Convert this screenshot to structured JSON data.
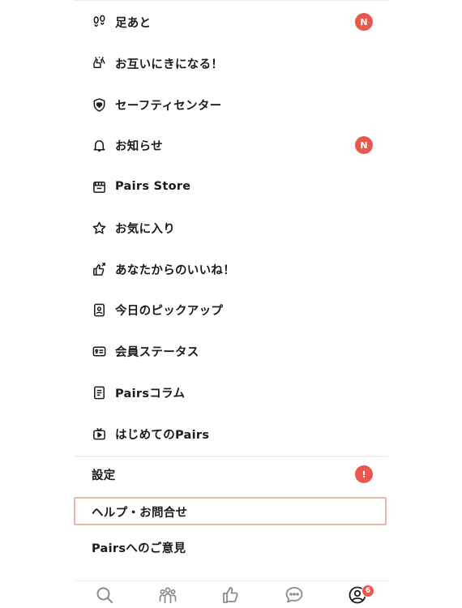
{
  "menu": {
    "items": [
      {
        "label": "足あと",
        "icon": "footprints-icon",
        "badge": "N"
      },
      {
        "label": "お互いにきになる！",
        "icon": "mutual-like-icon",
        "badge": ""
      },
      {
        "label": "セーフティセンター",
        "icon": "shield-heart-icon",
        "badge": ""
      },
      {
        "label": "お知らせ",
        "icon": "bell-icon",
        "badge": "N"
      },
      {
        "label": "Pairs Store",
        "icon": "store-icon",
        "badge": ""
      },
      {
        "label": "お気に入り",
        "icon": "star-icon",
        "badge": ""
      },
      {
        "label": "あなたからのいいね！",
        "icon": "thumbs-up-sent-icon",
        "badge": ""
      },
      {
        "label": "今日のピックアップ",
        "icon": "profile-card-icon",
        "badge": ""
      },
      {
        "label": "会員ステータス",
        "icon": "membership-card-icon",
        "badge": ""
      },
      {
        "label": "Pairsコラム",
        "icon": "article-icon",
        "badge": ""
      },
      {
        "label": "はじめてのPairs",
        "icon": "tv-icon",
        "badge": ""
      }
    ],
    "settings_label": "設定",
    "settings_badge": "!",
    "help_label": "ヘルプ・お問合せ",
    "feedback_label": "Pairsへのご意見"
  },
  "tabbar": {
    "tabs": [
      {
        "icon": "search-icon"
      },
      {
        "icon": "community-icon"
      },
      {
        "icon": "like-icon"
      },
      {
        "icon": "message-icon"
      },
      {
        "icon": "profile-icon",
        "badge": "6"
      }
    ]
  },
  "colors": {
    "accent": "#e8584f",
    "highlight": "#f0b3ad"
  }
}
